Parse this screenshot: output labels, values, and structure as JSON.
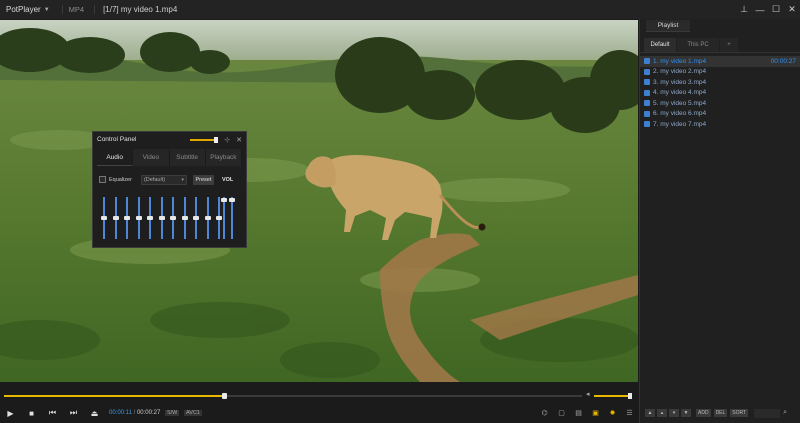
{
  "titlebar": {
    "app_name": "PotPlayer",
    "format": "MP4",
    "title": "[1/7] my video 1.mp4",
    "pin": "⊥",
    "minimize": "—",
    "maximize": "☐",
    "close": "✕"
  },
  "control_panel": {
    "title": "Control Panel",
    "tabs": [
      "Audio",
      "Video",
      "Subtitle",
      "Playback"
    ],
    "active_tab": "Audio",
    "equalizer_label": "Equalizer",
    "equalizer_checked": false,
    "preset_value": "(Default)",
    "preset_button": "Preset",
    "vol_label": "VOL",
    "eq_levels": [
      0.5,
      0.5,
      0.5,
      0.5,
      0.5,
      0.5,
      0.5,
      0.5,
      0.5,
      0.5,
      0.5
    ],
    "vol_levels": [
      0.92,
      0.92
    ]
  },
  "playback": {
    "progress": 0.38,
    "volume": 1.0,
    "current_time": "00:00:11",
    "total_time": "00:00:27",
    "tag1": "S/W",
    "tag2": "AVC1"
  },
  "playlist": {
    "title": "Playlist",
    "tabs": [
      "Default",
      "This PC",
      "+"
    ],
    "items": [
      {
        "label": "1. my video 1.mp4",
        "duration": "00:00:27",
        "active": true
      },
      {
        "label": "2. my video 2.mp4",
        "duration": "",
        "active": false
      },
      {
        "label": "3. my video 3.mp4",
        "duration": "",
        "active": false
      },
      {
        "label": "4. my video 4.mp4",
        "duration": "",
        "active": false
      },
      {
        "label": "5. my video 5.mp4",
        "duration": "",
        "active": false
      },
      {
        "label": "6. my video 6.mp4",
        "duration": "",
        "active": false
      },
      {
        "label": "7. my video 7.mp4",
        "duration": "",
        "active": false
      }
    ],
    "footer": {
      "add": "ADD",
      "del": "DEL",
      "sort": "SORT"
    }
  },
  "colors": {
    "accent_yellow": "#e8b800",
    "accent_blue": "#2f8ef0",
    "eq_blue": "#4e86d8"
  }
}
